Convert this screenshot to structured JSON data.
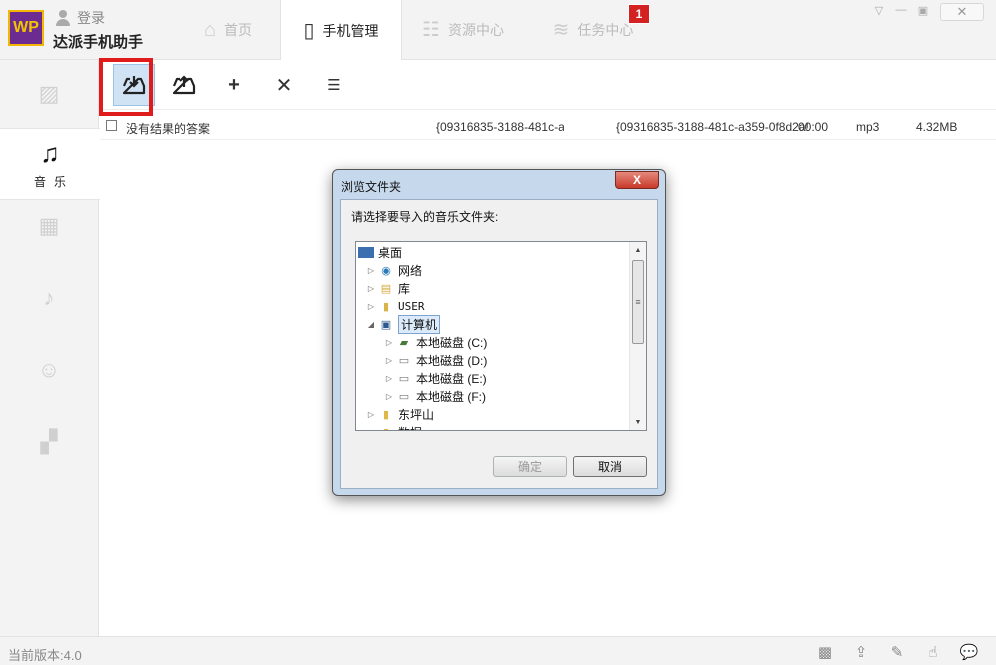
{
  "app": {
    "logo_text": "WP",
    "login_label": "登录",
    "name": "达派手机助手"
  },
  "tabs": [
    {
      "label": "首页",
      "icon": "home-icon"
    },
    {
      "label": "手机管理",
      "icon": "phone-icon"
    },
    {
      "label": "资源中心",
      "icon": "grid-icon"
    },
    {
      "label": "任务中心",
      "icon": "layers-icon"
    }
  ],
  "task_badge": "1",
  "sidebar": {
    "items": [
      {
        "icon": "image-icon",
        "label": ""
      },
      {
        "icon": "music-note-icon",
        "label": "音乐"
      },
      {
        "icon": "film-icon",
        "label": ""
      },
      {
        "icon": "bell-icon",
        "label": ""
      },
      {
        "icon": "contacts-icon",
        "label": ""
      },
      {
        "icon": "apps-grid-icon",
        "label": ""
      }
    ]
  },
  "toolbar": {
    "tools": [
      "import-icon",
      "export-icon",
      "add-icon",
      "delete-icon",
      "list-check-icon"
    ]
  },
  "file_list": [
    {
      "title": "没有结果的答案",
      "col2": "{09316835-3188-481c-a3!",
      "col3": "{09316835-3188-481c-a359-0f8d2a!",
      "duration": "00:00",
      "format": "mp3",
      "size": "4.32MB"
    }
  ],
  "statusbar": {
    "version": "当前版本:4.0",
    "icons": [
      "qr-code-icon",
      "upload-icon",
      "edit-icon",
      "hand-pointer-icon",
      "chat-icon"
    ]
  },
  "dialog": {
    "title": "浏览文件夹",
    "close_label": "X",
    "prompt": "请选择要导入的音乐文件夹:",
    "tree": [
      {
        "label": "桌面",
        "level": 0,
        "arrow": "",
        "icon": "desktop-icon"
      },
      {
        "label": "网络",
        "level": 1,
        "arrow": "▷",
        "icon": "network-icon"
      },
      {
        "label": "库",
        "level": 1,
        "arrow": "▷",
        "icon": "library-icon"
      },
      {
        "label": "USER",
        "level": 1,
        "arrow": "▷",
        "icon": "user-folder-icon"
      },
      {
        "label": "计算机",
        "level": 1,
        "arrow": "◢",
        "icon": "computer-icon",
        "selected": true
      },
      {
        "label": "本地磁盘 (C:)",
        "level": 2,
        "arrow": "▷",
        "icon": "system-drive-icon"
      },
      {
        "label": "本地磁盘 (D:)",
        "level": 2,
        "arrow": "▷",
        "icon": "drive-icon"
      },
      {
        "label": "本地磁盘 (E:)",
        "level": 2,
        "arrow": "▷",
        "icon": "drive-icon"
      },
      {
        "label": "本地磁盘 (F:)",
        "level": 2,
        "arrow": "▷",
        "icon": "drive-icon"
      },
      {
        "label": "东坪山",
        "level": 1,
        "arrow": "▷",
        "icon": "folder-icon"
      },
      {
        "label": "数据",
        "level": 1,
        "arrow": "",
        "icon": "folder-icon"
      }
    ],
    "ok_label": "确定",
    "cancel_label": "取消"
  }
}
